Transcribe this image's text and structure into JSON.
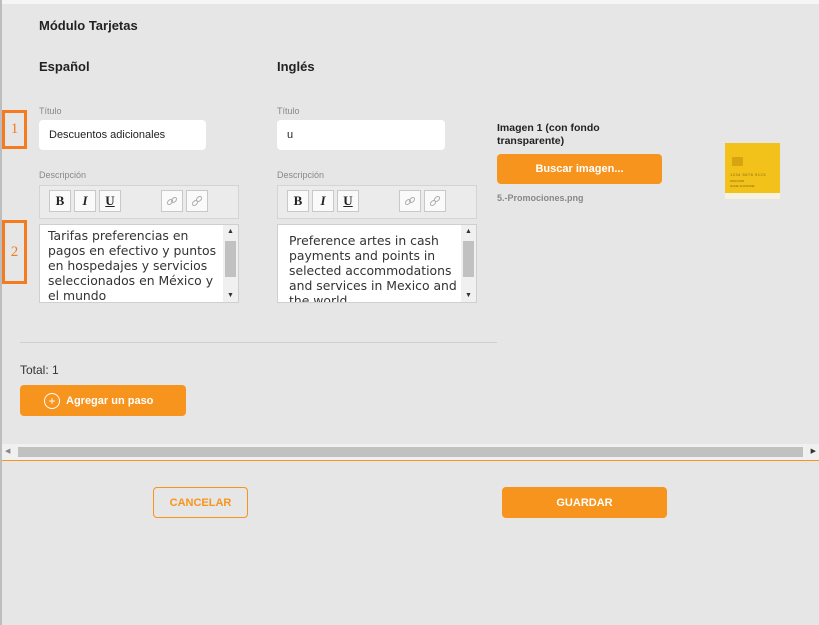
{
  "module": {
    "title": "Módulo Tarjetas"
  },
  "spanish": {
    "heading": "Español",
    "title_label": "Título",
    "title_value": "Descuentos adicionales",
    "description_label": "Descripción",
    "description_text": "Tarifas preferencias en pagos en efectivo y puntos en hospedajes y servicios seleccionados en México y el mundo"
  },
  "english": {
    "heading": "Inglés",
    "title_label": "Título",
    "title_value": "u",
    "description_label": "Descripción",
    "description_text": "Preference artes in cash payments and points in selected accommodations and services in Mexico and the world"
  },
  "toolbar": {
    "bold": "B",
    "italic": "I",
    "underline": "U",
    "link_icon": "link-icon",
    "unlink_icon": "unlink-icon"
  },
  "markers": {
    "one": "1",
    "two": "2"
  },
  "image": {
    "label": "Imagen 1 (con fondo transparente)",
    "search_button": "Buscar imagen...",
    "file_name": "5.-Promociones.png",
    "card_number": "1234 5678 9123",
    "card_small1": "0000 0000",
    "card_small2": "NAME SURNAME"
  },
  "steps": {
    "total": "Total: 1",
    "add_button": "Agregar un paso"
  },
  "footer": {
    "cancel": "CANCELAR",
    "save": "GUARDAR"
  },
  "colors": {
    "accent": "#f7941d",
    "marker": "#f47b20"
  }
}
